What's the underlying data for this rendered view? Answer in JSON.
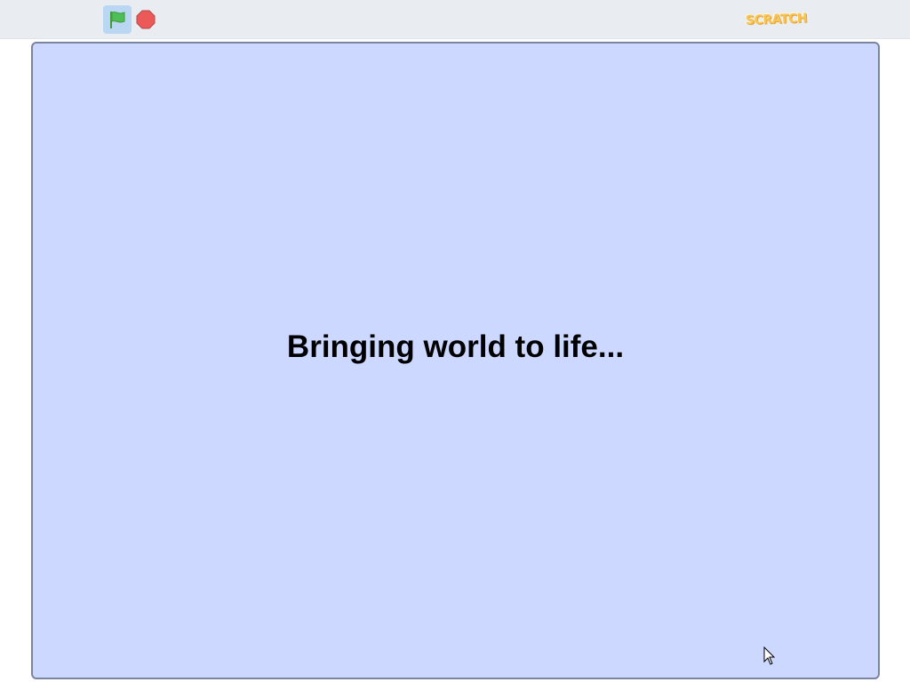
{
  "toolbar": {
    "green_flag": {
      "icon": "green-flag-icon",
      "color": "#4cbf56"
    },
    "stop": {
      "icon": "stop-sign-icon",
      "color": "#ec5959"
    },
    "logo_text": "SCRATCH"
  },
  "stage": {
    "background": "#ccd8ff",
    "message": "Bringing world to life..."
  }
}
